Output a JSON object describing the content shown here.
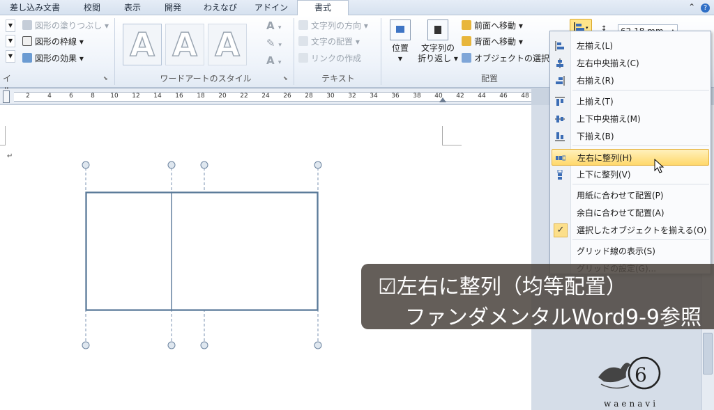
{
  "tabs": [
    "差し込み文書",
    "校閲",
    "表示",
    "開発",
    "わえなび",
    "アドイン",
    "書式"
  ],
  "active_tab": "書式",
  "ribbon": {
    "shape_styles": {
      "fill": "図形の塗りつぶし",
      "outline": "図形の枠線",
      "effects": "図形の効果",
      "group_label_partial": "イル"
    },
    "wordart": {
      "letter": "A",
      "group_label": "ワードアートのスタイル"
    },
    "text_group": {
      "direction": "文字列の方向",
      "align": "文字の配置",
      "link": "リンクの作成",
      "group_label": "テキスト"
    },
    "arrange": {
      "position": "位置",
      "wrap_line1": "文字列の",
      "wrap_line2": "折り返し",
      "bring_forward": "前面へ移動",
      "send_backward": "背面へ移動",
      "selection_pane": "オブジェクトの選択と表",
      "group_label": "配置"
    },
    "size_value": "62.18 mm"
  },
  "ruler": {
    "numbers": [
      "2",
      "4",
      "6",
      "8",
      "10",
      "12",
      "14",
      "16",
      "18",
      "20",
      "22",
      "24",
      "26",
      "28",
      "30",
      "32",
      "34",
      "36",
      "38",
      "40",
      "42",
      "44",
      "46",
      "48"
    ]
  },
  "menu": {
    "items": [
      {
        "label": "左揃え(L)",
        "icon": "align-left-icon"
      },
      {
        "label": "左右中央揃え(C)",
        "icon": "align-center-icon"
      },
      {
        "label": "右揃え(R)",
        "icon": "align-right-icon"
      },
      {
        "label": "上揃え(T)",
        "icon": "align-top-icon"
      },
      {
        "label": "上下中央揃え(M)",
        "icon": "align-middle-icon"
      },
      {
        "label": "下揃え(B)",
        "icon": "align-bottom-icon"
      },
      {
        "label": "左右に整列(H)",
        "icon": "distribute-horizontal-icon",
        "highlighted": true
      },
      {
        "label": "上下に整列(V)",
        "icon": "distribute-vertical-icon"
      },
      {
        "label": "用紙に合わせて配置(P)"
      },
      {
        "label": "余白に合わせて配置(A)"
      },
      {
        "label": "選択したオブジェクトを揃える(O)",
        "checked": true
      },
      {
        "label": "グリッド線の表示(S)"
      },
      {
        "label": "グリッドの設定(G)..."
      }
    ]
  },
  "caption": {
    "line1": "☑左右に整列（均等配置）",
    "line2": "ファンダメンタルWord9-9参照"
  },
  "logo_text": "waenavi",
  "colors": {
    "ribbon_bg": "#eef3fa",
    "highlight": "#ffd86b",
    "shape_stroke": "#5a7a99",
    "caption_bg": "#4e4842"
  }
}
